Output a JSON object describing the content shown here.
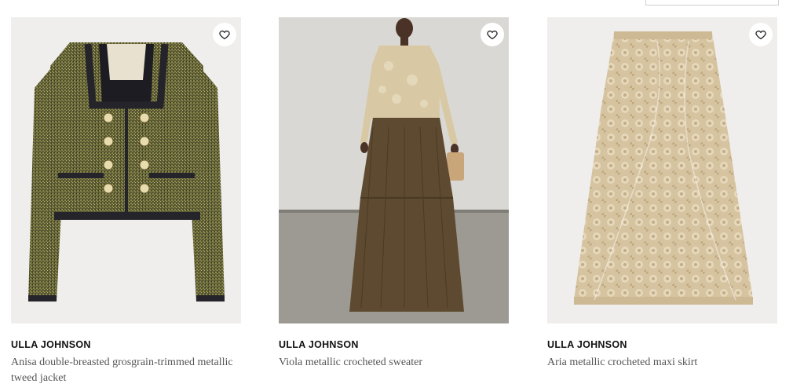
{
  "products": [
    {
      "brand": "ULLA JOHNSON",
      "name": "Anisa double-breasted grosgrain-trimmed metallic tweed jacket",
      "image": "tweed-jacket-image"
    },
    {
      "brand": "ULLA JOHNSON",
      "name": "Viola metallic crocheted sweater",
      "image": "model-in-crocheted-sweater-image"
    },
    {
      "brand": "ULLA JOHNSON",
      "name": "Aria metallic crocheted maxi skirt",
      "image": "crocheted-maxi-skirt-image"
    }
  ],
  "wishlist_icon": "heart-icon",
  "colors": {
    "brand_text": "#111111",
    "name_text": "#555555",
    "image_bg": "#efeeec"
  }
}
